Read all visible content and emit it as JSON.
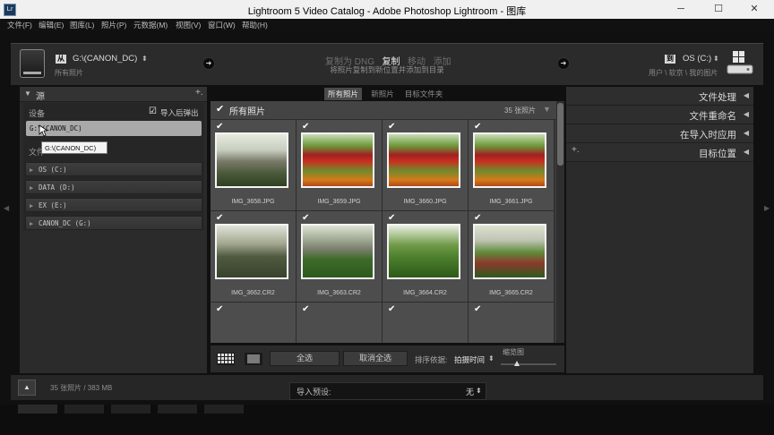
{
  "window": {
    "title": "Lightroom 5 Video Catalog - Adobe Photoshop Lightroom - 图库",
    "app_icon": "Lr",
    "controls": [
      "─",
      "☐",
      "✕"
    ]
  },
  "menu": [
    "文件(F)",
    "编辑(E)",
    "图库(L)",
    "照片(P)",
    "元数据(M)",
    "视图(V)",
    "窗口(W)",
    "帮助(H)"
  ],
  "header": {
    "from_badge": "从",
    "from_source": "G:\\(CANON_DC)",
    "from_sub": "所有照片",
    "modes": [
      "复制为 DNG",
      "复制",
      "移动",
      "添加"
    ],
    "active_mode": "复制",
    "mode_description": "将照片复制到新位置并添加到目录",
    "to_badge": "到",
    "to_target": "OS (C:)",
    "to_path": "用户 \\ 软京 \\ 我的图片"
  },
  "source_panel": {
    "title": "源",
    "plus": "+.",
    "device_label": "设备",
    "eject_label": "导入后弹出",
    "eject_checked": true,
    "selected_device": "G:\\(CANON_DC)",
    "tooltip": "G:\\(CANON_DC)",
    "files_label": "文件",
    "drives": [
      "OS (C:)",
      "DATA (D:)",
      "EX (E:)",
      "CANON_DC (G:)"
    ]
  },
  "view_tabs": {
    "items": [
      "所有照片",
      "新照片",
      "目标文件夹"
    ],
    "active": "所有照片"
  },
  "grid": {
    "header_label": "所有照片",
    "count_label": "35 张照片",
    "photos": [
      {
        "filename": "IMG_3658.JPG",
        "checked": true
      },
      {
        "filename": "IMG_3659.JPG",
        "checked": true
      },
      {
        "filename": "IMG_3660.JPG",
        "checked": true
      },
      {
        "filename": "IMG_3661.JPG",
        "checked": true
      },
      {
        "filename": "IMG_3662.CR2",
        "checked": true
      },
      {
        "filename": "IMG_3663.CR2",
        "checked": true
      },
      {
        "filename": "IMG_3664.CR2",
        "checked": true
      },
      {
        "filename": "IMG_3665.CR2",
        "checked": true
      },
      {
        "filename": "",
        "checked": true
      },
      {
        "filename": "",
        "checked": true
      },
      {
        "filename": "",
        "checked": true
      },
      {
        "filename": "",
        "checked": true
      }
    ]
  },
  "toolbar": {
    "select_all": "全选",
    "deselect_all": "取消全选",
    "sort_label": "排序依据:",
    "sort_value": "拍摄时间",
    "thumb_label": "缩览图"
  },
  "right_panels": {
    "items": [
      "文件处理",
      "文件重命名",
      "在导入时应用",
      "目标位置"
    ]
  },
  "footer": {
    "summary": "35 张照片 / 383 MB",
    "preset_label": "导入预设:",
    "preset_value": "无"
  }
}
